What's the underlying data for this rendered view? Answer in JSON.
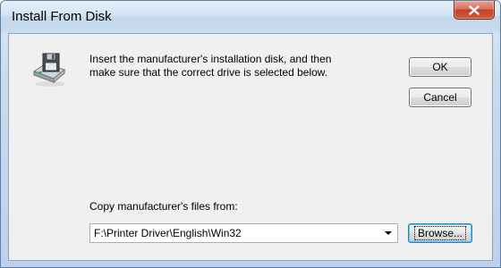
{
  "window": {
    "title": "Install From Disk"
  },
  "message": {
    "line1": "Insert the manufacturer's installation disk, and then",
    "line2": "make sure that the correct drive is selected below."
  },
  "buttons": {
    "ok_label": "OK",
    "cancel_label": "Cancel",
    "browse_label": "Browse..."
  },
  "copy_from": {
    "label": "Copy manufacturer's files from:",
    "value": "F:\\Printer Driver\\English\\Win32"
  },
  "icons": {
    "disk": "disk-drive-icon",
    "close": "close-icon",
    "dropdown": "chevron-down-icon"
  },
  "colors": {
    "close_button": "#c4432a",
    "dialog_background": "#f0f0f0",
    "title_bar": "#c9dbee"
  }
}
